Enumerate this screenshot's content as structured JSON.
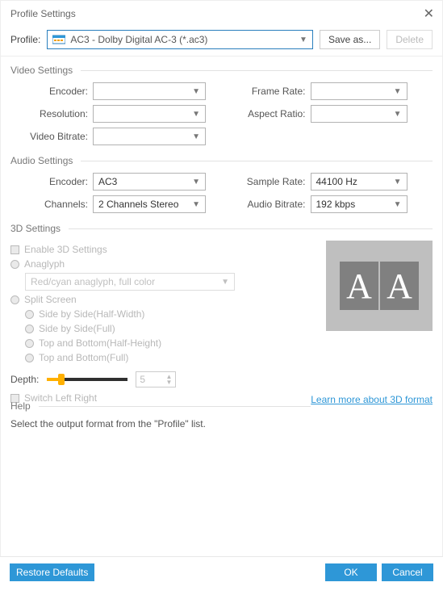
{
  "window": {
    "title": "Profile Settings"
  },
  "profile_row": {
    "label": "Profile:",
    "value": "AC3 - Dolby Digital AC-3 (*.ac3)",
    "save_as": "Save as...",
    "delete": "Delete"
  },
  "video": {
    "header": "Video Settings",
    "encoder_label": "Encoder:",
    "encoder": "",
    "resolution_label": "Resolution:",
    "resolution": "",
    "bitrate_label": "Video Bitrate:",
    "bitrate": "",
    "frame_rate_label": "Frame Rate:",
    "frame_rate": "",
    "aspect_label": "Aspect Ratio:",
    "aspect": ""
  },
  "audio": {
    "header": "Audio Settings",
    "encoder_label": "Encoder:",
    "encoder": "AC3",
    "channels_label": "Channels:",
    "channels": "2 Channels Stereo",
    "sample_rate_label": "Sample Rate:",
    "sample_rate": "44100 Hz",
    "bitrate_label": "Audio Bitrate:",
    "bitrate": "192 kbps"
  },
  "d3": {
    "header": "3D Settings",
    "enable": "Enable 3D Settings",
    "anaglyph": "Anaglyph",
    "anaglyph_value": "Red/cyan anaglyph, full color",
    "split_screen": "Split Screen",
    "sbs_half": "Side by Side(Half-Width)",
    "sbs_full": "Side by Side(Full)",
    "tab_half": "Top and Bottom(Half-Height)",
    "tab_full": "Top and Bottom(Full)",
    "depth_label": "Depth:",
    "depth_value": "5",
    "switch_lr": "Switch Left Right",
    "learn_more": "Learn more about 3D format",
    "preview_a": "A",
    "preview_b": "A"
  },
  "help": {
    "header": "Help",
    "text": "Select the output format from the \"Profile\" list."
  },
  "footer": {
    "restore": "Restore Defaults",
    "ok": "OK",
    "cancel": "Cancel"
  }
}
